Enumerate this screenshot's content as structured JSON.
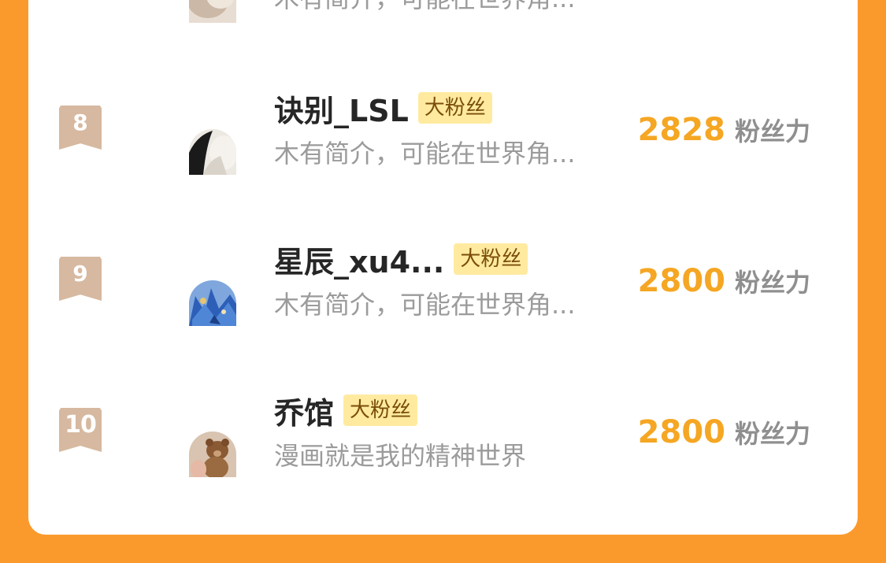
{
  "partial_previous": {
    "intro": "木有简介，可能在世界角..."
  },
  "ranking": [
    {
      "rank": "8",
      "name": "诀别_LSL",
      "badge": "大粉丝",
      "intro": "木有简介，可能在世界角...",
      "score": "2828",
      "unit": "粉丝力",
      "avatar_icon": "avatar-dark-hair"
    },
    {
      "rank": "9",
      "name": "星辰_xu4...",
      "badge": "大粉丝",
      "intro": "木有简介，可能在世界角...",
      "score": "2800",
      "unit": "粉丝力",
      "avatar_icon": "avatar-blue-anime"
    },
    {
      "rank": "10",
      "name": "乔馆",
      "badge": "大粉丝",
      "intro": "漫画就是我的精神世界",
      "score": "2800",
      "unit": "粉丝力",
      "avatar_icon": "avatar-teddy-bear"
    }
  ],
  "colors": {
    "background": "#fb9a2c",
    "score": "#f5a623",
    "badge_bg": "#ffeaa0",
    "rank_flag": "#d6b9a0"
  }
}
